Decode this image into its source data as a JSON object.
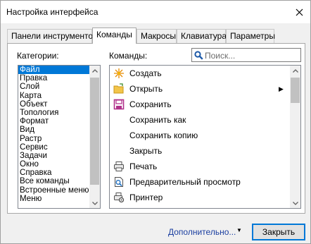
{
  "dialog": {
    "title": "Настройка интерфейса"
  },
  "tabs": [
    {
      "label": "Панели инструментов",
      "active": false
    },
    {
      "label": "Команды",
      "active": true
    },
    {
      "label": "Макросы",
      "active": false
    },
    {
      "label": "Клавиатура",
      "active": false
    },
    {
      "label": "Параметры",
      "active": false
    }
  ],
  "categories": {
    "label": "Категории:",
    "selected": "Файл",
    "items": [
      "Файл",
      "Правка",
      "Слой",
      "Карта",
      "Объект",
      "Топология",
      "Формат",
      "Вид",
      "Растр",
      "Сервис",
      "Задачи",
      "Окно",
      "Справка",
      "Все команды",
      "Встроенные меню",
      "Меню"
    ]
  },
  "commands": {
    "label": "Команды:",
    "search_placeholder": "Поиск...",
    "items": [
      {
        "label": "Создать",
        "icon": "new-document-icon"
      },
      {
        "label": "Открыть",
        "icon": "open-folder-icon",
        "submenu": true
      },
      {
        "label": "Сохранить",
        "icon": "save-disk-icon"
      },
      {
        "label": "Сохранить как",
        "icon": ""
      },
      {
        "label": "Сохранить копию",
        "icon": ""
      },
      {
        "label": "Закрыть",
        "icon": ""
      },
      {
        "label": "Печать",
        "icon": "printer-icon"
      },
      {
        "label": "Предварительный просмотр",
        "icon": "print-preview-icon"
      },
      {
        "label": "Принтер",
        "icon": "printer-settings-icon"
      }
    ]
  },
  "footer": {
    "more_label": "Дополнительно...",
    "close_label": "Закрыть"
  },
  "colors": {
    "selection": "#0078d7",
    "link": "#1a3ea0"
  }
}
